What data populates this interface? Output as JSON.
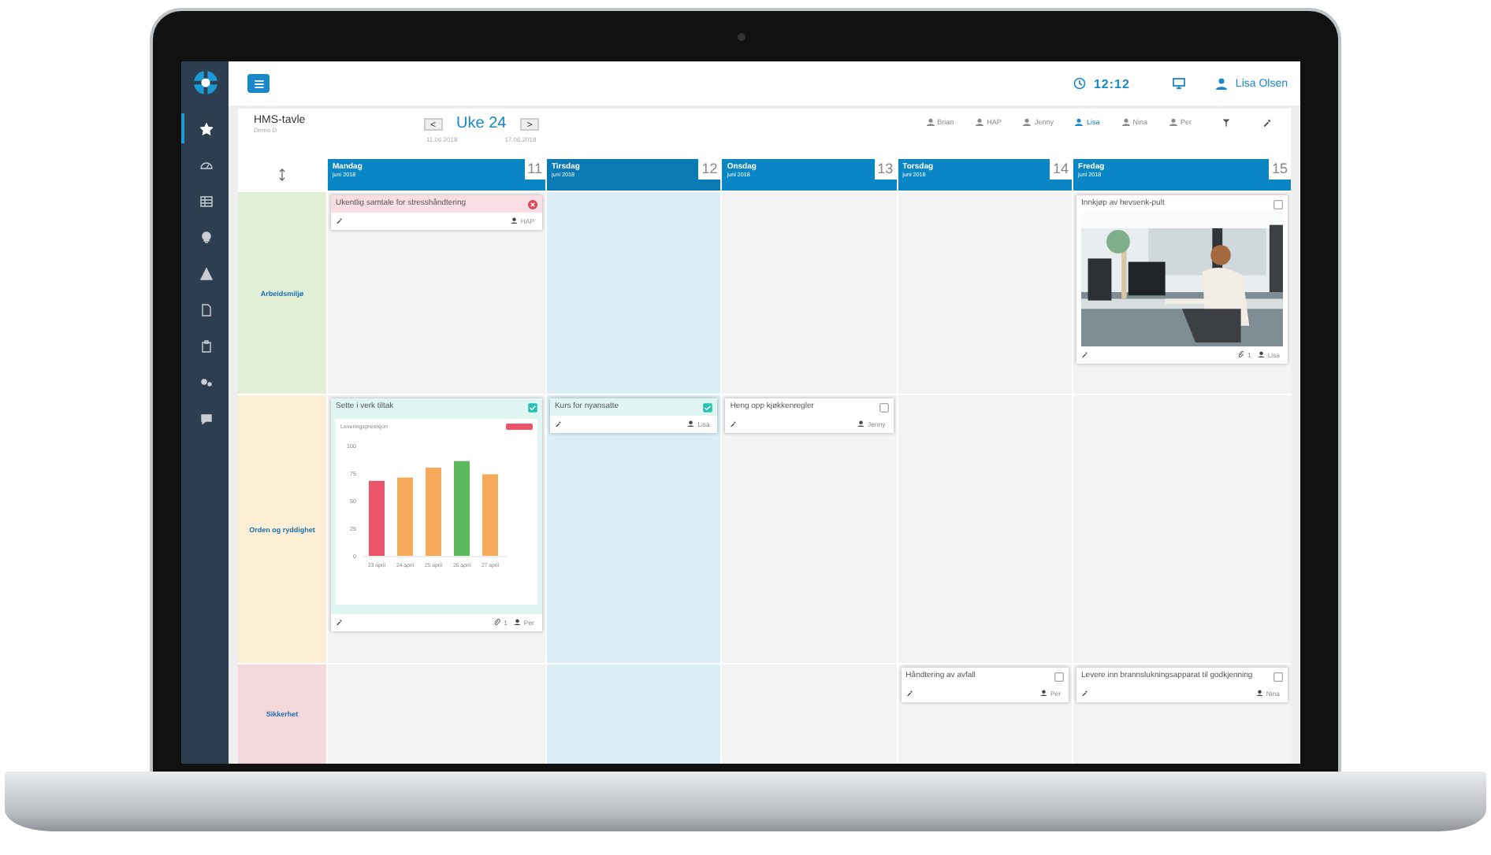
{
  "sidebar": {
    "items": [
      {
        "selected": true
      },
      {
        "selected": false
      },
      {
        "selected": false
      },
      {
        "selected": false
      },
      {
        "selected": false
      },
      {
        "selected": false
      },
      {
        "selected": false
      },
      {
        "selected": false
      },
      {
        "selected": false
      }
    ]
  },
  "topbar": {
    "time": "12:12",
    "user": "Lisa Olsen"
  },
  "board": {
    "title": "HMS-tavle",
    "subtitle": "Demo D",
    "prev": "<",
    "week": "Uke 24",
    "next": ">",
    "start_date": "11.06.2018",
    "end_date": "17.06.2018"
  },
  "people": [
    {
      "name": "Brian",
      "selected": false
    },
    {
      "name": "HAP",
      "selected": false
    },
    {
      "name": "Jenny",
      "selected": false
    },
    {
      "name": "Lisa",
      "selected": true
    },
    {
      "name": "Nina",
      "selected": false
    },
    {
      "name": "Per",
      "selected": false
    }
  ],
  "days": [
    {
      "name": "Mandag",
      "month": "juni 2018",
      "date": "11",
      "selected": false
    },
    {
      "name": "Tirsdag",
      "month": "juni 2018",
      "date": "12",
      "selected": true
    },
    {
      "name": "Onsdag",
      "month": "juni 2018",
      "date": "13",
      "selected": false
    },
    {
      "name": "Torsdag",
      "month": "juni 2018",
      "date": "14",
      "selected": false
    },
    {
      "name": "Fredag",
      "month": "juni 2018",
      "date": "15",
      "selected": false
    }
  ],
  "categories": [
    {
      "name": "Arbeidsmiljø",
      "color": "#e3f0d8",
      "cells": [
        [
          {
            "title": "Ukentlig samtale for stresshåndtering",
            "overdue": true,
            "assignee": "HAP"
          }
        ],
        [],
        [],
        [],
        [
          {
            "title": "Innkjøp av hevsenk-pult",
            "checked": false,
            "overdue": false,
            "attachments": "1",
            "assignee": "Lisa"
          }
        ]
      ]
    },
    {
      "name": "Orden og ryddighet",
      "color": "#fcefd6",
      "cells": [
        [
          {
            "title": "Sette i verk tiltak",
            "checked": true,
            "overdue": false,
            "content": {
              "kind": "chart",
              "chart_data": {
                "type": "bar",
                "title": "Leveringspresisjon",
                "categories": [
                  "23 april",
                  "24 april",
                  "25 april",
                  "26 april",
                  "27 april"
                ],
                "series": [
                  {
                    "color": "#e9566a",
                    "values": [
                      68,
                      null,
                      null,
                      null,
                      null
                    ]
                  },
                  {
                    "color": "#f5a95a",
                    "values": [
                      null,
                      71,
                      80,
                      null,
                      74
                    ]
                  },
                  {
                    "color": "#5cb85c",
                    "values": [
                      null,
                      null,
                      null,
                      86,
                      null
                    ]
                  }
                ],
                "ylim": [
                  0,
                  100
                ],
                "yticks": [
                  0,
                  25,
                  50,
                  75,
                  100
                ]
              }
            },
            "attachments": "1",
            "assignee": "Per"
          }
        ],
        [
          {
            "title": "Kurs for nyansatte",
            "checked": true,
            "overdue": false,
            "assignee": "Lisa"
          }
        ],
        [
          {
            "title": "Heng opp kjøkkenregler",
            "checked": false,
            "overdue": false,
            "assignee": "Jenny"
          }
        ],
        [],
        []
      ]
    },
    {
      "name": "Sikkerhet",
      "color": "#f4d8dc",
      "cells": [
        [],
        [],
        [],
        [
          {
            "title": "Håndtering av avfall",
            "checked": false,
            "overdue": false,
            "assignee": "Per"
          }
        ],
        [
          {
            "title": "Levere inn brannslukningsapparat til godkjenning",
            "checked": false,
            "overdue": false,
            "assignee": "Nina"
          }
        ]
      ]
    }
  ]
}
